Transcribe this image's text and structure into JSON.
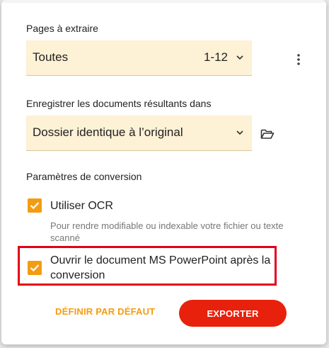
{
  "pages": {
    "section_label": "Pages à extraire",
    "selected_value": "Toutes",
    "range_text": "1-12"
  },
  "output": {
    "section_label": "Enregistrer les documents résultants dans",
    "selected_value": "Dossier identique à l’original"
  },
  "conversion": {
    "section_label": "Paramètres de conversion",
    "ocr_label": "Utiliser OCR",
    "ocr_checked": true,
    "ocr_hint": "Pour rendre modifiable ou indexable votre fichier ou texte scanné",
    "open_ppt_label_line1": "Ouvrir le document MS PowerPoint après la",
    "open_ppt_label_line2": "conversion",
    "open_ppt_checked": true
  },
  "buttons": {
    "set_default_label": "DÉFINIR PAR DÉFAUT",
    "export_label": "EXPORTER"
  },
  "icons": {
    "more": "more-vertical-icon",
    "folder": "folder-open-icon",
    "chevron": "chevron-down-icon",
    "check": "check-icon"
  },
  "colors": {
    "accent": "#f39c12",
    "export": "#e8210c",
    "field_bg": "#fdf1d6",
    "highlight": "#e3001b"
  }
}
